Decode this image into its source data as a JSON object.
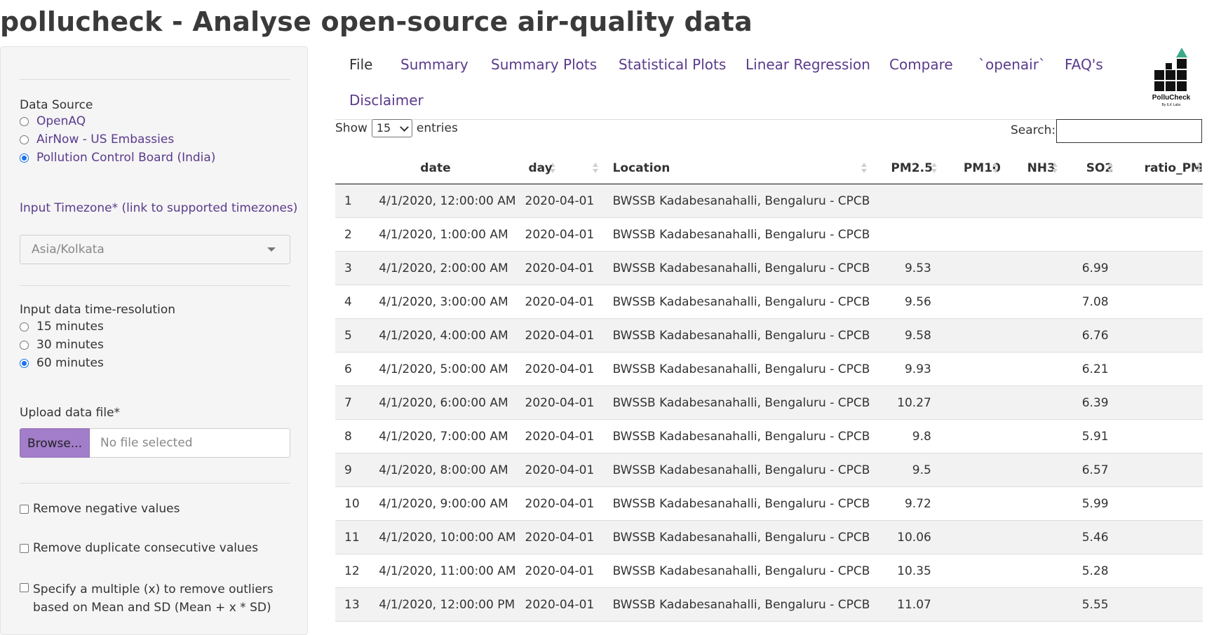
{
  "app": {
    "title": "pollucheck - Analyse open-source air-quality data"
  },
  "sidebar": {
    "data_source": {
      "label": "Data Source",
      "options": [
        "OpenAQ",
        "AirNow - US Embassies",
        "Pollution Control Board (India)"
      ],
      "selected": "Pollution Control Board (India)"
    },
    "timezone": {
      "label": "Input Timezone* (link to supported timezones)",
      "value": "Asia/Kolkata"
    },
    "resolution": {
      "label": "Input data time-resolution",
      "options": [
        "15 minutes",
        "30 minutes",
        "60 minutes"
      ],
      "selected": "60 minutes"
    },
    "upload": {
      "label": "Upload data file*",
      "browse_label": "Browse...",
      "file_placeholder": "No file selected"
    },
    "checks": {
      "remove_negative": "Remove negative values",
      "remove_duplicate": "Remove duplicate consecutive values",
      "outliers": "Specify a multiple (x) to remove outliers based on Mean and SD (Mean + x * SD)"
    }
  },
  "nav": {
    "tabs": [
      "File",
      "Summary",
      "Summary Plots",
      "Statistical Plots",
      "Linear Regression",
      "Compare",
      "`openair`",
      "FAQ's",
      "Disclaimer"
    ],
    "active": "File"
  },
  "logo": {
    "text": "PolluCheck",
    "subtext": "By ILK Labs"
  },
  "table": {
    "show_label": "Show",
    "entries_label": "entries",
    "page_length": "15",
    "search_label": "Search:",
    "columns": [
      "",
      "date",
      "day",
      "Location",
      "PM2.5",
      "PM10",
      "NH3",
      "SO2",
      "ratio_PM"
    ],
    "rows": [
      [
        "1",
        "4/1/2020, 12:00:00 AM",
        "2020-04-01",
        "BWSSB Kadabesanahalli, Bengaluru - CPCB",
        "",
        "",
        "",
        "",
        ""
      ],
      [
        "2",
        "4/1/2020, 1:00:00 AM",
        "2020-04-01",
        "BWSSB Kadabesanahalli, Bengaluru - CPCB",
        "",
        "",
        "",
        "",
        ""
      ],
      [
        "3",
        "4/1/2020, 2:00:00 AM",
        "2020-04-01",
        "BWSSB Kadabesanahalli, Bengaluru - CPCB",
        "9.53",
        "",
        "",
        "6.99",
        ""
      ],
      [
        "4",
        "4/1/2020, 3:00:00 AM",
        "2020-04-01",
        "BWSSB Kadabesanahalli, Bengaluru - CPCB",
        "9.56",
        "",
        "",
        "7.08",
        ""
      ],
      [
        "5",
        "4/1/2020, 4:00:00 AM",
        "2020-04-01",
        "BWSSB Kadabesanahalli, Bengaluru - CPCB",
        "9.58",
        "",
        "",
        "6.76",
        ""
      ],
      [
        "6",
        "4/1/2020, 5:00:00 AM",
        "2020-04-01",
        "BWSSB Kadabesanahalli, Bengaluru - CPCB",
        "9.93",
        "",
        "",
        "6.21",
        ""
      ],
      [
        "7",
        "4/1/2020, 6:00:00 AM",
        "2020-04-01",
        "BWSSB Kadabesanahalli, Bengaluru - CPCB",
        "10.27",
        "",
        "",
        "6.39",
        ""
      ],
      [
        "8",
        "4/1/2020, 7:00:00 AM",
        "2020-04-01",
        "BWSSB Kadabesanahalli, Bengaluru - CPCB",
        "9.8",
        "",
        "",
        "5.91",
        ""
      ],
      [
        "9",
        "4/1/2020, 8:00:00 AM",
        "2020-04-01",
        "BWSSB Kadabesanahalli, Bengaluru - CPCB",
        "9.5",
        "",
        "",
        "6.57",
        ""
      ],
      [
        "10",
        "4/1/2020, 9:00:00 AM",
        "2020-04-01",
        "BWSSB Kadabesanahalli, Bengaluru - CPCB",
        "9.72",
        "",
        "",
        "5.99",
        ""
      ],
      [
        "11",
        "4/1/2020, 10:00:00 AM",
        "2020-04-01",
        "BWSSB Kadabesanahalli, Bengaluru - CPCB",
        "10.06",
        "",
        "",
        "5.46",
        ""
      ],
      [
        "12",
        "4/1/2020, 11:00:00 AM",
        "2020-04-01",
        "BWSSB Kadabesanahalli, Bengaluru - CPCB",
        "10.35",
        "",
        "",
        "5.28",
        ""
      ],
      [
        "13",
        "4/1/2020, 12:00:00 PM",
        "2020-04-01",
        "BWSSB Kadabesanahalli, Bengaluru - CPCB",
        "11.07",
        "",
        "",
        "5.55",
        ""
      ]
    ]
  },
  "colors": {
    "accent": "#5a3a8c",
    "button": "#a27dc9",
    "radio": "#1a73e8",
    "logo_triangle": "#3aaa8a"
  }
}
